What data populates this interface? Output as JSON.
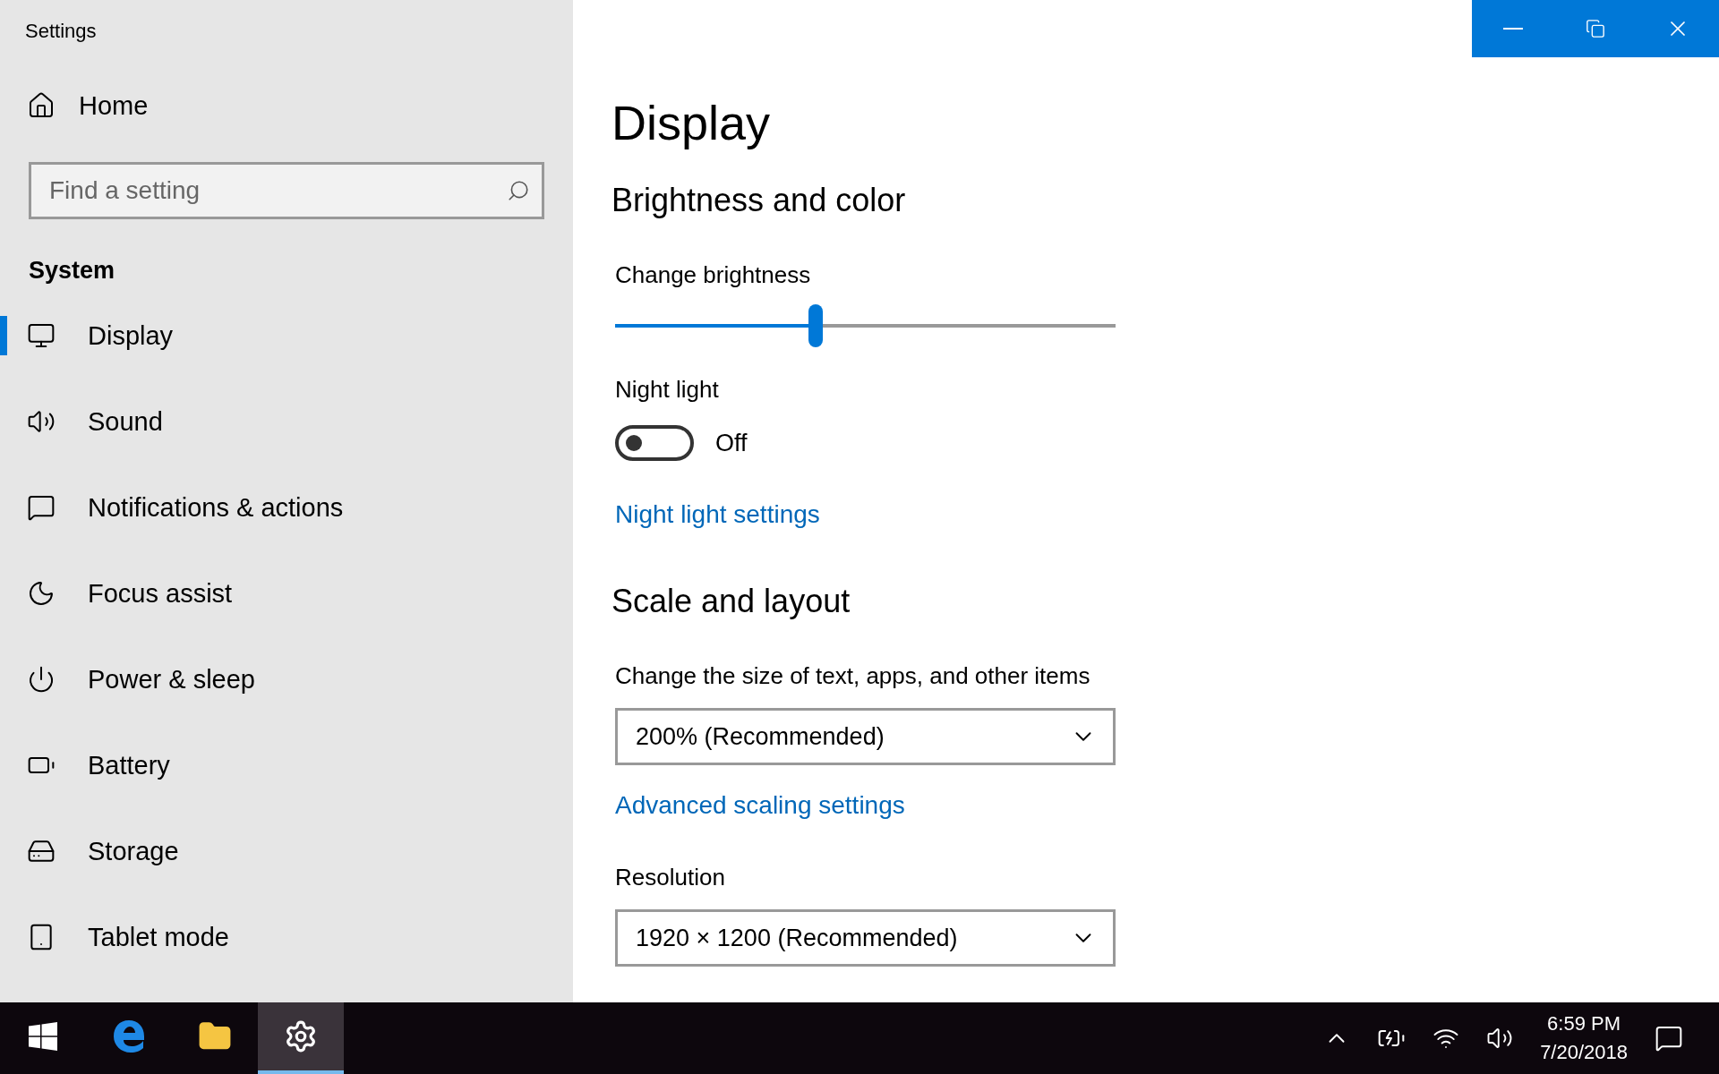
{
  "window": {
    "title": "Settings"
  },
  "sidebar": {
    "home": "Home",
    "search": {
      "placeholder": "Find a setting"
    },
    "section": "System",
    "items": [
      {
        "label": "Display",
        "selected": true
      },
      {
        "label": "Sound",
        "selected": false
      },
      {
        "label": "Notifications & actions",
        "selected": false
      },
      {
        "label": "Focus assist",
        "selected": false
      },
      {
        "label": "Power & sleep",
        "selected": false
      },
      {
        "label": "Battery",
        "selected": false
      },
      {
        "label": "Storage",
        "selected": false
      },
      {
        "label": "Tablet mode",
        "selected": false
      }
    ]
  },
  "page": {
    "title": "Display",
    "content": [
      {
        "kind": "heading",
        "text": "Brightness and color"
      },
      {
        "kind": "slider",
        "label": "Change brightness",
        "level": 0.4
      },
      {
        "kind": "toggle",
        "label": "Night light",
        "on": false,
        "state_text": "Off"
      },
      {
        "kind": "link",
        "text": "Night light settings"
      },
      {
        "kind": "heading",
        "text": "Scale and layout"
      },
      {
        "kind": "dropdown",
        "label": "Change the size of text, apps, and other items",
        "value": "200% (Recommended)"
      },
      {
        "kind": "link",
        "text": "Advanced scaling settings"
      },
      {
        "kind": "dropdown",
        "label": "Resolution",
        "value": "1920 × 1200 (Recommended)"
      }
    ]
  },
  "taskbar": {
    "apps": [
      {
        "selected": false
      },
      {
        "selected": false
      },
      {
        "selected": false
      },
      {
        "selected": true
      }
    ],
    "time": "6:59 PM",
    "date": "7/20/2018"
  }
}
